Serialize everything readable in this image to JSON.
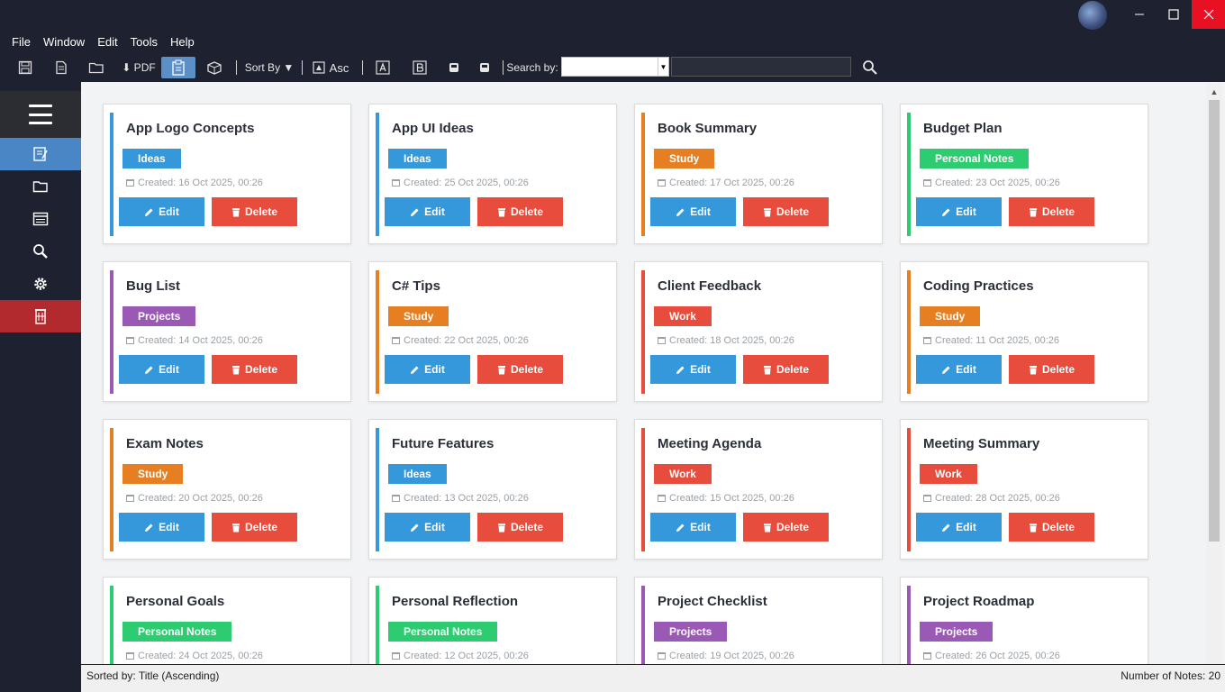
{
  "colors": {
    "ideas": "#3498db",
    "study": "#e67e22",
    "personal": "#2ecc71",
    "projects": "#9b59b6",
    "work": "#e74c3c"
  },
  "window": {
    "minimize_icon": "minimize-icon",
    "maximize_icon": "maximize-icon",
    "close_icon": "close-icon"
  },
  "menu": [
    "File",
    "Window",
    "Edit",
    "Tools",
    "Help"
  ],
  "toolbar": {
    "pdf_label": "⬇ PDF",
    "sort_label": "Sort By ▼",
    "asc_label": "Asc",
    "search_label": "Search by:",
    "search_value": ""
  },
  "sidebar": {
    "items": [
      "notes-icon",
      "folder-icon",
      "list-icon",
      "search-icon",
      "settings-icon",
      "trash-icon"
    ]
  },
  "notes": [
    {
      "title": "App Logo Concepts",
      "category": "Ideas",
      "color": "#3498db",
      "created": "Created: 16 Oct 2025, 00:26"
    },
    {
      "title": "App UI Ideas",
      "category": "Ideas",
      "color": "#3498db",
      "created": "Created: 25 Oct 2025, 00:26"
    },
    {
      "title": "Book Summary",
      "category": "Study",
      "color": "#e67e22",
      "created": "Created: 17 Oct 2025, 00:26"
    },
    {
      "title": "Budget Plan",
      "category": "Personal Notes",
      "color": "#2ecc71",
      "created": "Created: 23 Oct 2025, 00:26"
    },
    {
      "title": "Bug List",
      "category": "Projects",
      "color": "#9b59b6",
      "created": "Created: 14 Oct 2025, 00:26"
    },
    {
      "title": "C# Tips",
      "category": "Study",
      "color": "#e67e22",
      "created": "Created: 22 Oct 2025, 00:26"
    },
    {
      "title": "Client Feedback",
      "category": "Work",
      "color": "#e74c3c",
      "created": "Created: 18 Oct 2025, 00:26"
    },
    {
      "title": "Coding Practices",
      "category": "Study",
      "color": "#e67e22",
      "created": "Created: 11 Oct 2025, 00:26"
    },
    {
      "title": "Exam Notes",
      "category": "Study",
      "color": "#e67e22",
      "created": "Created: 20 Oct 2025, 00:26"
    },
    {
      "title": "Future Features",
      "category": "Ideas",
      "color": "#3498db",
      "created": "Created: 13 Oct 2025, 00:26"
    },
    {
      "title": "Meeting Agenda",
      "category": "Work",
      "color": "#e74c3c",
      "created": "Created: 15 Oct 2025, 00:26"
    },
    {
      "title": "Meeting Summary",
      "category": "Work",
      "color": "#e74c3c",
      "created": "Created: 28 Oct 2025, 00:26"
    },
    {
      "title": "Personal Goals",
      "category": "Personal Notes",
      "color": "#2ecc71",
      "created": "Created: 24 Oct 2025, 00:26"
    },
    {
      "title": "Personal Reflection",
      "category": "Personal Notes",
      "color": "#2ecc71",
      "created": "Created: 12 Oct 2025, 00:26"
    },
    {
      "title": "Project Checklist",
      "category": "Projects",
      "color": "#9b59b6",
      "created": "Created: 19 Oct 2025, 00:26"
    },
    {
      "title": "Project Roadmap",
      "category": "Projects",
      "color": "#9b59b6",
      "created": "Created: 26 Oct 2025, 00:26"
    }
  ],
  "card_buttons": {
    "edit": "Edit",
    "delete": "Delete"
  },
  "status": {
    "sorted_by": "Sorted by: Title (Ascending)",
    "count": "Number of Notes: 20"
  }
}
